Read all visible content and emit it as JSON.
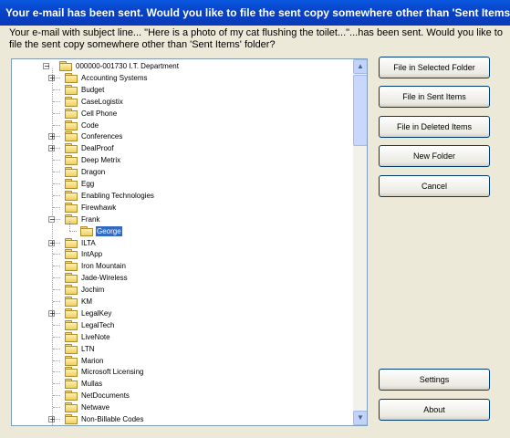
{
  "window": {
    "title": "Your e-mail has been sent.  Would you like to file the sent copy somewhere other than 'Sent Items' folder?"
  },
  "message": "Your e-mail with subject line... \"Here is a photo of my cat flushing the toilet...\"...has been sent. Would you like to file the sent copy somewhere other than 'Sent Items' folder?",
  "tree": {
    "root": {
      "label": "000000-001730  I.T. Department",
      "expander": "−"
    },
    "items": [
      {
        "label": "Accounting Systems",
        "expander": "+",
        "level": 1
      },
      {
        "label": "Budget",
        "expander": "",
        "level": 1
      },
      {
        "label": "CaseLogistix",
        "expander": "",
        "level": 1
      },
      {
        "label": "Cell Phone",
        "expander": "",
        "level": 1
      },
      {
        "label": "Code",
        "expander": "",
        "level": 1
      },
      {
        "label": "Conferences",
        "expander": "+",
        "level": 1
      },
      {
        "label": "DealProof",
        "expander": "+",
        "level": 1
      },
      {
        "label": "Deep Metrix",
        "expander": "",
        "level": 1
      },
      {
        "label": "Dragon",
        "expander": "",
        "level": 1
      },
      {
        "label": "Egg",
        "expander": "",
        "level": 1
      },
      {
        "label": "Enabling Technologies",
        "expander": "",
        "level": 1
      },
      {
        "label": "Firewhawk",
        "expander": "",
        "level": 1
      },
      {
        "label": "Frank",
        "expander": "−",
        "level": 1
      },
      {
        "label": "George",
        "expander": "",
        "level": 2,
        "selected": true
      },
      {
        "label": "ILTA",
        "expander": "+",
        "level": 1
      },
      {
        "label": "IntApp",
        "expander": "",
        "level": 1
      },
      {
        "label": "Iron Mountain",
        "expander": "",
        "level": 1
      },
      {
        "label": "Jade-Wireless",
        "expander": "",
        "level": 1
      },
      {
        "label": "Jochim",
        "expander": "",
        "level": 1
      },
      {
        "label": "KM",
        "expander": "",
        "level": 1
      },
      {
        "label": "LegalKey",
        "expander": "+",
        "level": 1
      },
      {
        "label": "LegalTech",
        "expander": "",
        "level": 1
      },
      {
        "label": "LiveNote",
        "expander": "",
        "level": 1
      },
      {
        "label": "LTN",
        "expander": "",
        "level": 1
      },
      {
        "label": "Marion",
        "expander": "",
        "level": 1
      },
      {
        "label": "Microsoft Licensing",
        "expander": "",
        "level": 1
      },
      {
        "label": "Mullas",
        "expander": "",
        "level": 1
      },
      {
        "label": "NetDocuments",
        "expander": "",
        "level": 1
      },
      {
        "label": "Netwave",
        "expander": "",
        "level": 1
      },
      {
        "label": "Non-Billable Codes",
        "expander": "+",
        "level": 1
      }
    ]
  },
  "scrollbar": {
    "up_arrow": "▲",
    "down_arrow": "▼"
  },
  "buttons": {
    "file_selected": "File in Selected Folder",
    "file_sent": "File in Sent Items",
    "file_deleted": "File in Deleted Items",
    "new_folder": "New Folder",
    "cancel": "Cancel",
    "settings": "Settings",
    "about": "About"
  },
  "colors": {
    "titlebar": "#0a47d0",
    "dialog_bg": "#ece9d8",
    "selection": "#316ac5",
    "folder": "#f0cf5c"
  }
}
